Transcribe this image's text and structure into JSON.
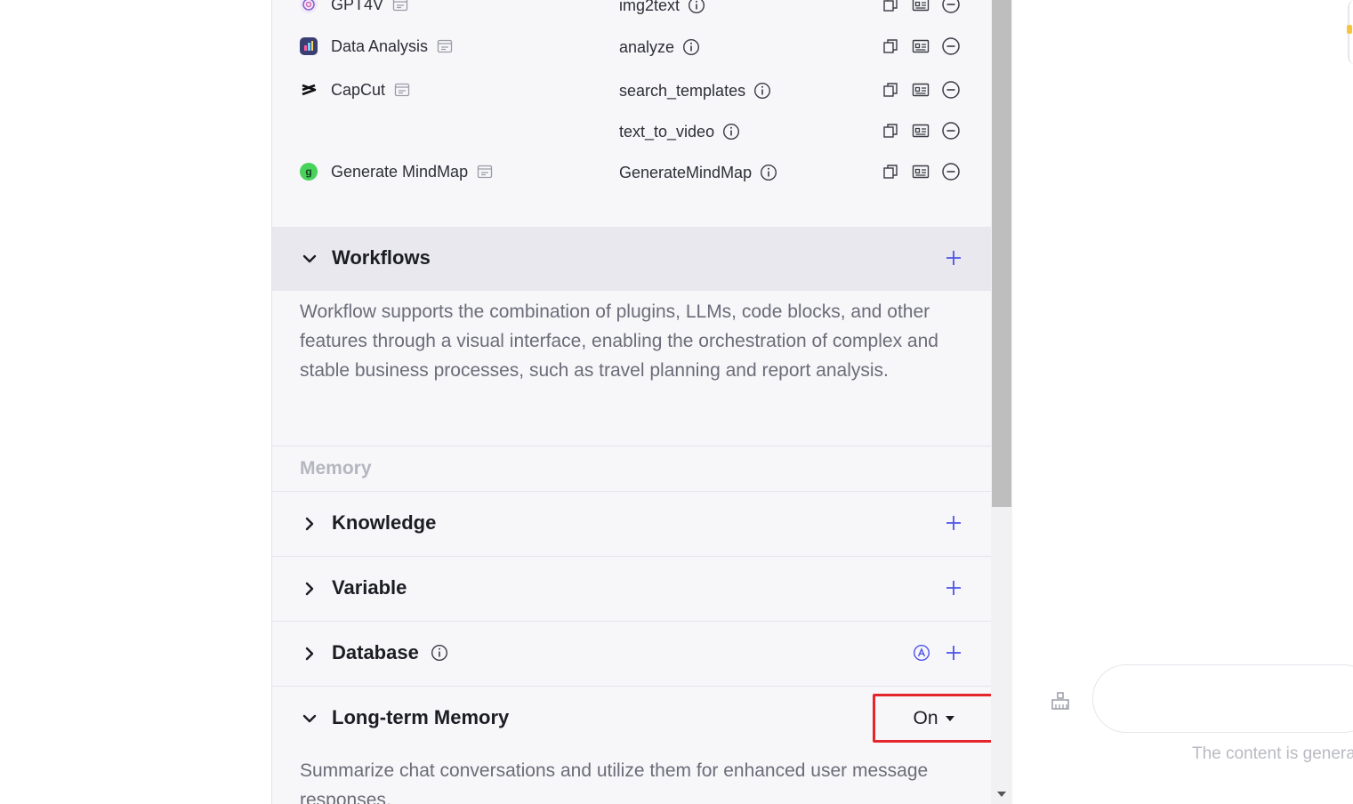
{
  "plugins": [
    {
      "name": "GPT4V",
      "tool": "img2text",
      "logo_color": "#e9e4f7",
      "logo_text": ""
    },
    {
      "name": "Data Analysis",
      "tool": "analyze",
      "logo_color": "#3a3f73",
      "logo_text": ""
    },
    {
      "name": "CapCut",
      "tool": "search_templates",
      "logo_color": "#ffffff",
      "logo_text": ""
    },
    {
      "name": "",
      "tool": "text_to_video"
    },
    {
      "name": "Generate MindMap",
      "tool": "GenerateMindMap",
      "logo_color": "#47d35a",
      "logo_text": "g"
    }
  ],
  "workflows": {
    "title": "Workflows",
    "description": "Workflow supports the combination of plugins, LLMs, code blocks, and other features through a visual interface, enabling the orchestration of complex and stable business processes, such as travel planning and report analysis."
  },
  "memory": {
    "header": "Memory",
    "knowledge": "Knowledge",
    "variable": "Variable",
    "database": "Database",
    "long_term": {
      "title": "Long-term Memory",
      "value": "On",
      "description": "Summarize chat conversations and utilize them for enhanced user message responses."
    }
  },
  "chat": {
    "input_placeholder": "",
    "footer_note": "The content is genera"
  },
  "colors": {
    "accent": "#4d53e8",
    "highlight_box": "#e4262a",
    "panel_bg": "#f7f7fa"
  },
  "icons": [
    "store-icon",
    "info-icon",
    "copy-icon",
    "card-icon",
    "minus-circle-icon",
    "chevron-down-icon",
    "chevron-right-icon",
    "plus-icon",
    "auto-icon",
    "broom-icon"
  ]
}
